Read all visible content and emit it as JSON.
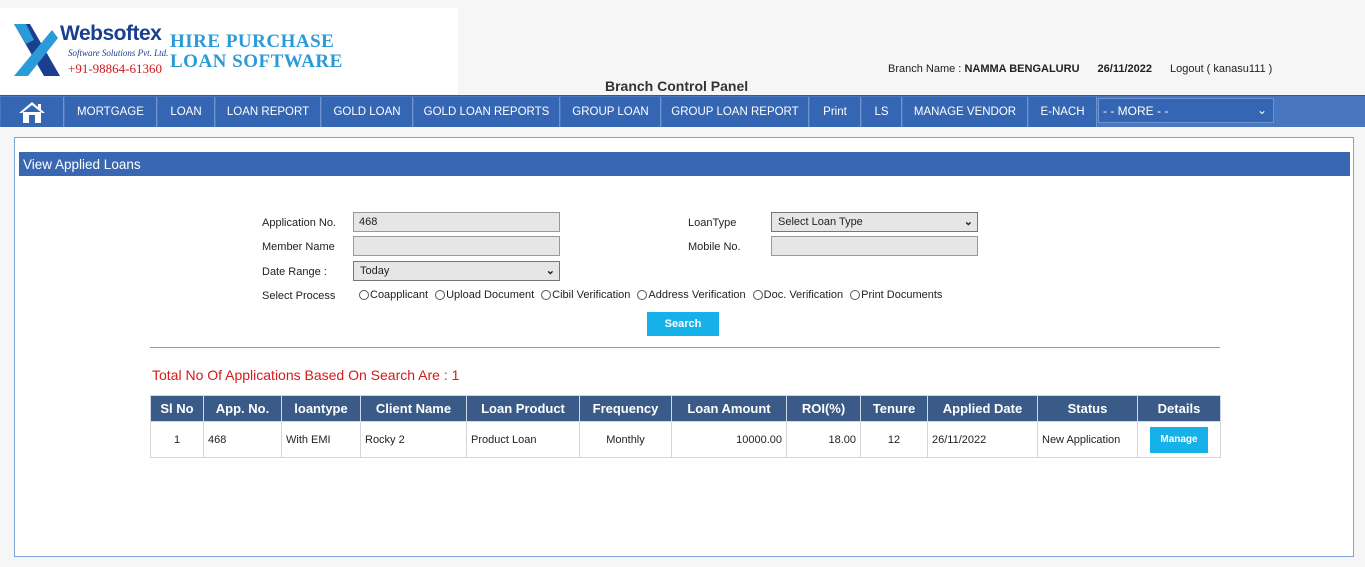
{
  "header": {
    "brand": "Websoftex",
    "brand_sub": "Software Solutions Pvt. Ltd.",
    "brand_phone": "+91-98864-61360",
    "product_line1": "HIRE PURCHASE",
    "product_line2": "LOAN SOFTWARE",
    "branch_label": "Branch Name :",
    "branch_name": "NAMMA BENGALURU",
    "date": "26/11/2022",
    "logout": "Logout ( kanasu111 )",
    "panel_title": "Branch Control Panel"
  },
  "nav": {
    "home_icon": "home-icon",
    "items": [
      "MORTGAGE",
      "LOAN",
      "LOAN REPORT",
      "GOLD LOAN",
      "GOLD LOAN REPORTS",
      "GROUP LOAN",
      "GROUP LOAN REPORT",
      "Print",
      "LS",
      "MANAGE VENDOR",
      "E-NACH"
    ],
    "more_selected": "- - MORE - -"
  },
  "section_title": "View Applied Loans",
  "form": {
    "application_no_label": "Application No.",
    "application_no_value": "468",
    "member_name_label": "Member Name",
    "member_name_value": "",
    "date_range_label": "Date Range :",
    "date_range_selected": "Today",
    "loan_type_label": "LoanType",
    "loan_type_selected": "Select Loan Type",
    "mobile_label": "Mobile No.",
    "mobile_value": "",
    "select_process_label": "Select Process",
    "process_options": [
      "Coapplicant",
      "Upload Document",
      "Cibil Verification",
      "Address Verification",
      "Doc. Verification",
      "Print Documents"
    ],
    "search_label": "Search"
  },
  "total_text": "Total No Of Applications Based On Search Are : 1",
  "table": {
    "headers": [
      "Sl No",
      "App. No.",
      "loantype",
      "Client Name",
      "Loan Product",
      "Frequency",
      "Loan Amount",
      "ROI(%)",
      "Tenure",
      "Applied Date",
      "Status",
      "Details"
    ],
    "rows": [
      {
        "sl_no": "1",
        "app_no": "468",
        "loantype": "With EMI",
        "client_name": "Rocky 2",
        "loan_product": "Product Loan",
        "frequency": "Monthly",
        "loan_amount": "10000.00",
        "roi": "18.00",
        "tenure": "12",
        "applied_date": "26/11/2022",
        "status": "New Application",
        "details_label": "Manage"
      }
    ]
  },
  "colors": {
    "nav_bg": "#3466b4",
    "section_bar": "#3a67b2",
    "table_header": "#3a5a88",
    "accent_button": "#16b1e8",
    "total_text": "#d21b1b"
  }
}
